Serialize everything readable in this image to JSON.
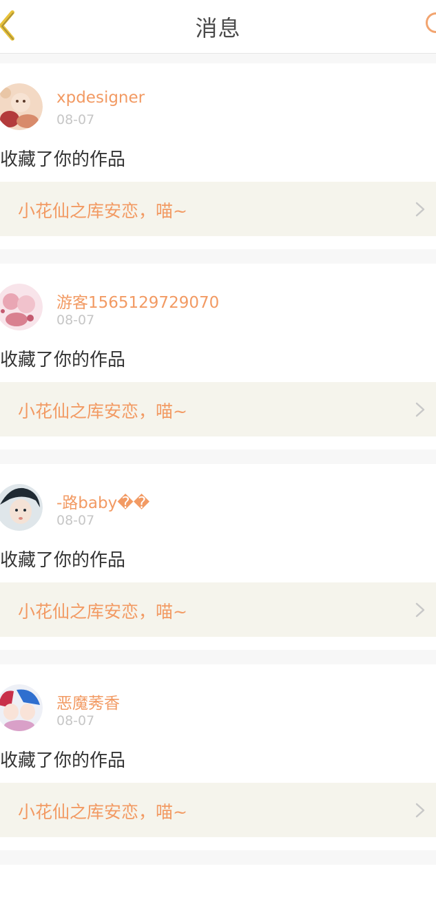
{
  "header": {
    "title": "消息",
    "back_icon": "chevron-left-icon",
    "right_icon": "circle-icon",
    "accent_color": "#f2a46f",
    "back_color": "#e8c23a"
  },
  "messages": [
    {
      "username": "xpdesigner",
      "date": "08-07",
      "action": "收藏了你的作品",
      "work_title": "小花仙之库安恋，喵~"
    },
    {
      "username": "游客1565129729070",
      "date": "08-07",
      "action": "收藏了你的作品",
      "work_title": "小花仙之库安恋，喵~"
    },
    {
      "username": "-路baby��",
      "date": "08-07",
      "action": "收藏了你的作品",
      "work_title": "小花仙之库安恋，喵~"
    },
    {
      "username": "恶魔莠香",
      "date": "08-07",
      "action": "收藏了你的作品",
      "work_title": "小花仙之库安恋，喵~"
    }
  ],
  "colors": {
    "username": "#f29a63",
    "date": "#c6c6c6",
    "action": "#333333",
    "work_bg": "#f5f4ec",
    "page_bg": "#f7f7f7"
  }
}
